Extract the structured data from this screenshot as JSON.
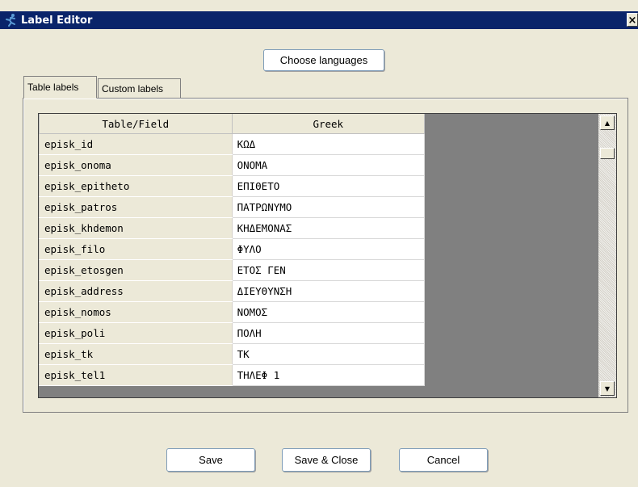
{
  "window": {
    "title": "Label Editor",
    "close_glyph": "×"
  },
  "choose_languages_label": "Choose languages",
  "tabs": [
    {
      "label": "Table labels",
      "active": true
    },
    {
      "label": "Custom labels",
      "active": false
    }
  ],
  "table": {
    "columns": [
      "Table/Field",
      "Greek"
    ],
    "rows": [
      {
        "field": "episk_id",
        "label": "ΚΩΔ"
      },
      {
        "field": "episk_onoma",
        "label": "ΟΝΟΜΑ"
      },
      {
        "field": "episk_epitheto",
        "label": "ΕΠΙΘΕΤΟ"
      },
      {
        "field": "episk_patros",
        "label": "ΠΑΤΡΩΝΥΜΟ"
      },
      {
        "field": "episk_khdemon",
        "label": "ΚΗΔΕΜΟΝΑΣ"
      },
      {
        "field": "episk_filo",
        "label": "ΦΥΛΟ"
      },
      {
        "field": "episk_etosgen",
        "label": "ΕΤΟΣ ΓΕΝ"
      },
      {
        "field": "episk_address",
        "label": "ΔΙΕΥΘΥΝΣΗ"
      },
      {
        "field": "episk_nomos",
        "label": "ΝΟΜΟΣ"
      },
      {
        "field": "episk_poli",
        "label": "ΠΟΛΗ"
      },
      {
        "field": "episk_tk",
        "label": "ΤΚ"
      },
      {
        "field": "episk_tel1",
        "label": "ΤΗΛΕΦ 1"
      }
    ]
  },
  "buttons": {
    "save": "Save",
    "save_close": "Save & Close",
    "cancel": "Cancel"
  },
  "icons": {
    "app": "running-figure-icon",
    "scroll_up": "scroll-up-arrow-icon",
    "scroll_down": "scroll-down-arrow-icon"
  },
  "colors": {
    "titlebar": "#0a246a",
    "dialog_bg": "#ece9d8",
    "empty_area": "#808080"
  }
}
